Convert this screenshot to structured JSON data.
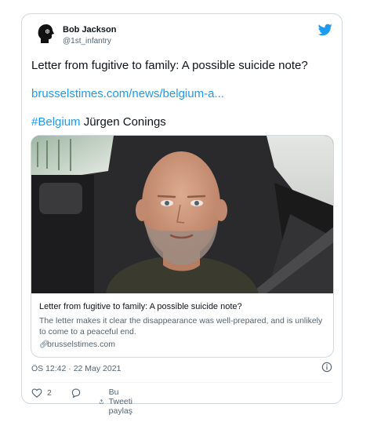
{
  "author": {
    "name": "Bob Jackson",
    "handle": "@1st_infantry"
  },
  "tweet": {
    "text": "Letter from fugitive to family: A possible suicide note?",
    "link": "brusselstimes.com/news/belgium-a...",
    "hashtag": "#Belgium",
    "name_text": " Jürgen Conings"
  },
  "preview": {
    "title": "Letter from fugitive to family: A possible suicide note?",
    "description": "The letter makes it clear the disappearance was well-prepared, and is unlikely to come to a peaceful end.",
    "domain": "brusselstimes.com"
  },
  "meta": {
    "timestamp": "ÖS 12:42 · 22 May 2021"
  },
  "actions": {
    "like_count": "2",
    "share_label": "Bu Tweeti paylaş"
  },
  "colors": {
    "accent": "#1d9bf0",
    "text": "#0f1419",
    "muted": "#536471",
    "border": "#cfd9de"
  },
  "icons": [
    "avatar-silhouette",
    "twitter-bird-icon",
    "info-icon",
    "heart-icon",
    "reply-icon",
    "share-icon",
    "link-icon"
  ]
}
